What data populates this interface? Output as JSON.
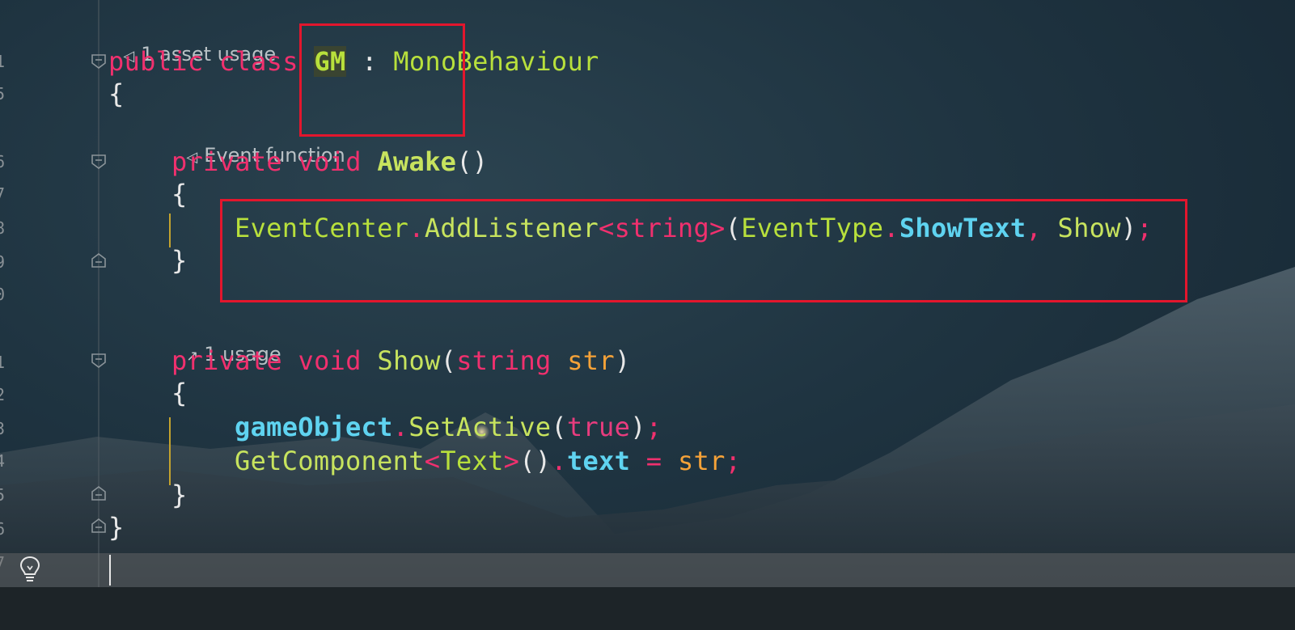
{
  "hints": {
    "asset_usage": "1 asset usage",
    "event_function": "Event function",
    "usage": "1 usage"
  },
  "code": {
    "line_class": {
      "kw1": "public",
      "kw2": "class",
      "name": "GM",
      "colon": ":",
      "base": "MonoBehaviour"
    },
    "open_class": "{",
    "line_awake": {
      "kw1": "private",
      "kw2": "void",
      "name": "Awake",
      "parens": "()"
    },
    "open_awake": "{",
    "line_listener": {
      "cls": "EventCenter",
      "dot1": ".",
      "method": "AddListener",
      "lt": "<",
      "generic": "string",
      "gt": ">",
      "lparen": "(",
      "enum": "EventType",
      "dot2": ".",
      "member": "ShowText",
      "comma": ",",
      "arg": "Show",
      "rparen": ")",
      "semi": ";"
    },
    "close_awake": "}",
    "line_show": {
      "kw1": "private",
      "kw2": "void",
      "name": "Show",
      "lparen": "(",
      "ptype": "string",
      "pname": "str",
      "rparen": ")"
    },
    "open_show": "{",
    "line_setactive": {
      "obj": "gameObject",
      "dot": ".",
      "method": "SetActive",
      "lparen": "(",
      "val": "true",
      "rparen": ")",
      "semi": ";"
    },
    "line_getcomp": {
      "method": "GetComponent",
      "lt": "<",
      "generic": "Text",
      "gt": ">",
      "call": "()",
      "dot": ".",
      "prop": "text",
      "eq": "=",
      "val": "str",
      "semi": ";"
    },
    "close_show": "}",
    "close_class": "}"
  },
  "line_numbers": [
    "1",
    "5",
    "6",
    "7",
    "8",
    "9",
    "0",
    "1",
    "2",
    "3",
    "4",
    "5",
    "6",
    "7"
  ],
  "colors": {
    "keyword": "#f0306e",
    "type": "#b8e03c",
    "method": "#c7e35e",
    "field": "#5fd3f0",
    "param": "#f5a238",
    "highlight_box": "#e3162d"
  }
}
